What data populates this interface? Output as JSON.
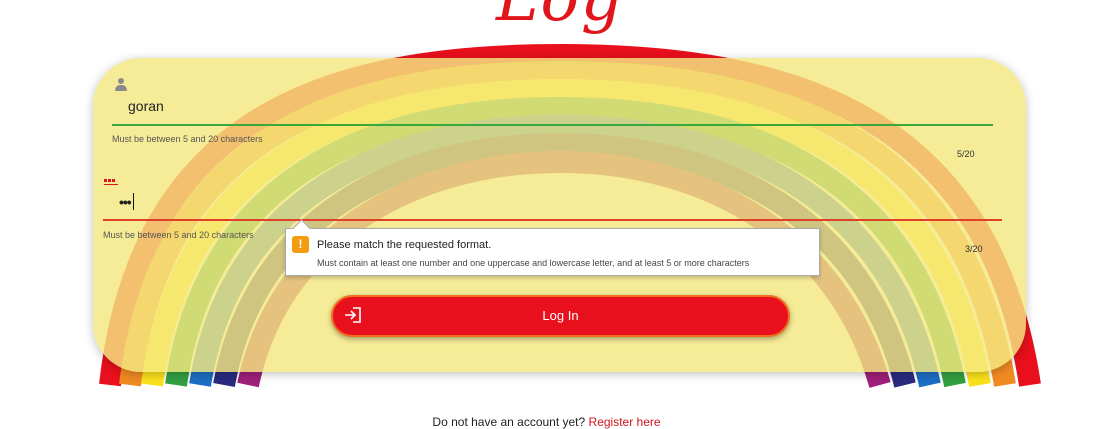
{
  "page": {
    "title": "Log In"
  },
  "form": {
    "username": {
      "value": "goran",
      "hint": "Must be between 5 and 20 characters",
      "counter": "5/20"
    },
    "password": {
      "value": "•••",
      "hint": "Must be between 5 and 20 characters",
      "counter": "3/20"
    },
    "submit_label": "Log In"
  },
  "validation_tooltip": {
    "title": "Please match the requested format.",
    "message": "Must contain at least one number and one uppercase and lowercase letter, and at least 5 or more characters",
    "icon": "warning-icon"
  },
  "footer": {
    "prompt": "Do not have an account yet? ",
    "link_label": "Register here"
  },
  "colors": {
    "accent": "#e8101c",
    "valid": "#3aa83a",
    "invalid": "#e0402a",
    "card": "#f4e880"
  }
}
